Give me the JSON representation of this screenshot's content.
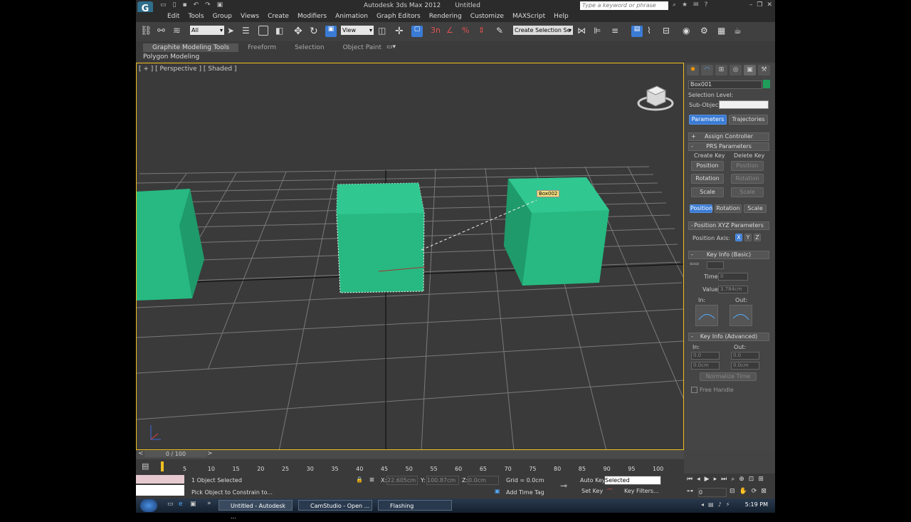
{
  "titlebar": {
    "title": "Autodesk 3ds Max 2012",
    "document": "Untitled",
    "search_placeholder": "Type a keyword or phrase"
  },
  "menu": [
    "Edit",
    "Tools",
    "Group",
    "Views",
    "Create",
    "Modifiers",
    "Animation",
    "Graph Editors",
    "Rendering",
    "Customize",
    "MAXScript",
    "Help"
  ],
  "toolbar": {
    "selection_filter": "All",
    "reference_coord": "View",
    "named_selection": "Create Selection Se"
  },
  "ribbon": {
    "tabs": [
      "Graphite Modeling Tools",
      "Freeform",
      "Selection",
      "Object Paint"
    ],
    "sub_label": "Polygon Modeling"
  },
  "viewport": {
    "label": "[ + ] [ Perspective ] [ Shaded ]",
    "tooltip": "Box002"
  },
  "command_panel": {
    "object_name": "Box001",
    "selection_level_label": "Selection Level:",
    "sub_object_label": "Sub-Object",
    "tab_parameters": "Parameters",
    "tab_trajectories": "Trajectories",
    "assign_controller": "Assign Controller",
    "prs_parameters": "PRS Parameters",
    "create_key": "Create Key",
    "delete_key": "Delete Key",
    "position": "Position",
    "rotation": "Rotation",
    "scale": "Scale",
    "position_xyz": "Position XYZ Parameters",
    "position_axis": "Position Axis:",
    "axis_x": "X",
    "axis_y": "Y",
    "axis_z": "Z",
    "key_info_basic": "Key Info (Basic)",
    "time_label": "Time:",
    "time_value": "0",
    "value_label": "Value:",
    "value_value": "3.784cm",
    "in_label": "In:",
    "out_label": "Out:",
    "key_info_adv": "Key Info (Advanced)",
    "adv_in": "In:",
    "adv_out": "Out:",
    "adv_in_val1": "0.0",
    "adv_out_val1": "0.0",
    "adv_in_val2": "0.0cm",
    "adv_out_val2": "0.0cm",
    "normalize_time": "Normalize Time",
    "free_handle": "Free Handle"
  },
  "timeslider": {
    "frame": "0 / 100"
  },
  "trackbar": {
    "ticks": [
      "5",
      "10",
      "15",
      "20",
      "25",
      "30",
      "35",
      "40",
      "45",
      "50",
      "55",
      "60",
      "65",
      "70",
      "75",
      "80",
      "85",
      "90",
      "95",
      "100"
    ]
  },
  "status": {
    "objects_selected": "1 Object Selected",
    "prompt": "Pick Object to Constrain to...",
    "x_label": "X:",
    "x_value": "22.605cm",
    "y_label": "Y:",
    "y_value": "100.87cm",
    "z_label": "Z:",
    "z_value": "0.0cm",
    "grid": "Grid = 0.0cm",
    "add_time_tag": "Add Time Tag"
  },
  "anim": {
    "auto_key": "Auto Key",
    "set_key": "Set Key",
    "selected": "Selected",
    "key_filters": "Key Filters...",
    "frame": "0"
  },
  "taskbar": {
    "items": [
      "Untitled - Autodesk ...",
      "CamStudio - Open ...",
      "Flashing"
    ],
    "time": "5:19 PM"
  }
}
